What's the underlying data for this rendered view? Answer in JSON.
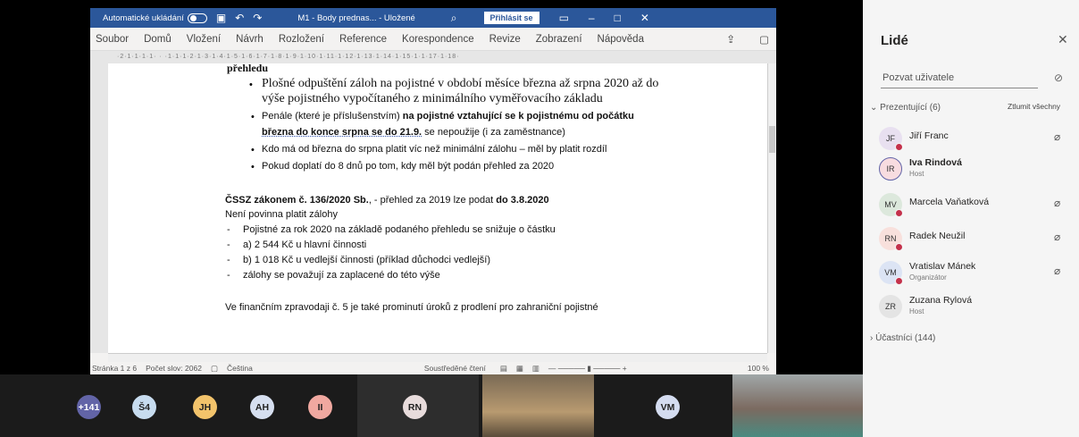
{
  "word": {
    "autosave_label": "Automatické ukládání",
    "doc_title": "M1 - Body prednas... - Uložené",
    "signin_label": "Přihlásit se",
    "tabs": [
      "Soubor",
      "Domů",
      "Vložení",
      "Návrh",
      "Rozložení",
      "Reference",
      "Korespondence",
      "Revize",
      "Zobrazení",
      "Nápověda"
    ],
    "ruler": "·2·1·1·1·1· · ·1·1·1·2·1·3·1·4·1·5·1·6·1·7·1·8·1·9·1·10·1·11·1·12·1·13·1·14·1·15·1·1·17·1·18·",
    "doc": {
      "line0": "přehledu",
      "b1a": "Plošné odpuštění záloh na pojistné v období měsíce března až srpna 2020 až do",
      "b1b": "výše pojistného vypočítaného z minimálního vyměřovacího základu",
      "b2a_normal": "Penále (které je příslušenstvím) ",
      "b2a_bold": "na pojistné vztahující se k pojistnému od počátku",
      "b2b_bold": "března  do konce  srpna se do 21.9.",
      "b2b_normal": " se nepoužije (i za zaměstnance)",
      "b3": "Kdo má od března do srpna platit víc než minimální zálohu – měl by platit rozdíl",
      "b4": "Pokud doplatí  do 8 dnů po tom, kdy měl být podán přehled za 2020",
      "p1_bold1": "ČSSZ zákonem č. 136/2020 Sb.",
      "p1_normal": ", - přehled za 2019 lze podat ",
      "p1_bold2": "do 3.8.2020",
      "p2": "Není povinna platit zálohy",
      "d1": "Pojistné za rok 2020 na základě podaného přehledu se snižuje o částku",
      "d2": "a) 2 544 Kč u hlavní činnosti",
      "d3": "b) 1 018 Kč u vedlejší činnosti (příklad důchodci vedlejší)",
      "d4": "zálohy se považují za zaplacené do této výše",
      "p3": "Ve finančním zpravodaji č. 5 je také prominutí úroků z prodlení pro zahraniční pojistné"
    },
    "status": {
      "page": "Stránka 1 z 6",
      "words": "Počet slov: 2062",
      "lang": "Čeština",
      "focus": "Soustředěné čtení",
      "zoom": "100 %"
    }
  },
  "people": {
    "title": "Lidé",
    "invite_placeholder": "Pozvat uživatele",
    "presenters_label": "Prezentující (6)",
    "mute_all": "Ztlumit všechny",
    "attendees_label": "Účastníci (144)",
    "members": [
      {
        "initials": "JF",
        "name": "Jiří Franc",
        "role": "",
        "color": "#e8e0f0"
      },
      {
        "initials": "IR",
        "name": "Iva Rindová",
        "role": "Host",
        "color": "#f8dce0"
      },
      {
        "initials": "MV",
        "name": "Marcela Vaňatková",
        "role": "",
        "color": "#dce8dc"
      },
      {
        "initials": "RN",
        "name": "Radek Neužil",
        "role": "",
        "color": "#f8e0dc"
      },
      {
        "initials": "VM",
        "name": "Vratislav Mánek",
        "role": "Organizátor",
        "color": "#dce4f4"
      },
      {
        "initials": "ZR",
        "name": "Zuzana Rylová",
        "role": "Host",
        "color": "#e4e4e4"
      }
    ]
  },
  "tiles": [
    {
      "label": "+141",
      "color": "#6264a7"
    },
    {
      "label": "Š4",
      "color": "#c7dcef"
    },
    {
      "label": "JH",
      "color": "#f2c36b"
    },
    {
      "label": "AH",
      "color": "#d6dff0"
    },
    {
      "label": "II",
      "color": "#f0a8a0"
    },
    {
      "label": "RN",
      "color": "#e8dcdc"
    },
    {
      "label": "VM",
      "color": "#d4dcf0"
    }
  ]
}
